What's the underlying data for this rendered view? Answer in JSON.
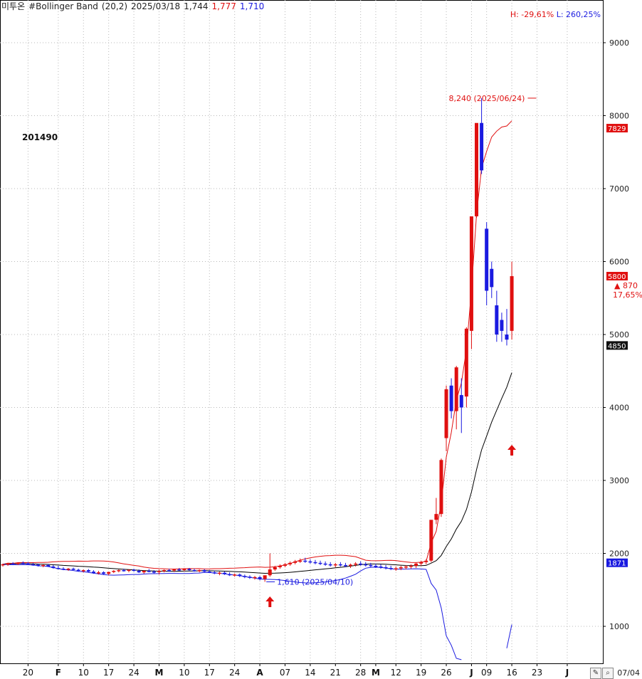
{
  "header": {
    "stock_name": "미투온",
    "indicator": "#Bollinger Band",
    "params": "(20,2)",
    "date": "2025/03/18",
    "close": "1,744",
    "high": "1,777",
    "low": "1,710"
  },
  "hl_stats": {
    "high_label": "H: -29,61%",
    "low_label": "L: 260,25%"
  },
  "ticker_code": "201490",
  "annotations": {
    "high_mark": "8,240 (2025/06/24)",
    "low_mark": "1,610 (2025/04/10)",
    "last_change": "870",
    "last_change_pct": "17,65%"
  },
  "price_badges": {
    "upper_band": "7829",
    "last_close": "5800",
    "middle_band": "4850",
    "lower_band": "1871"
  },
  "date_end": "07/04",
  "colors": {
    "up": "#e01010",
    "down": "#1a1ae0",
    "upper_band": "#e01010",
    "middle_band": "#000000",
    "lower_band": "#1a1ae0",
    "grid": "#b8b8b8"
  },
  "icons": [
    "draw-icon",
    "zoom-icon"
  ],
  "chart_data": {
    "type": "candlestick",
    "title": "미투온 #Bollinger Band (20,2)",
    "ylim": [
      500,
      9500
    ],
    "y_ticks": [
      1000,
      2000,
      3000,
      4000,
      5000,
      6000,
      7000,
      8000,
      9000
    ],
    "y_tick_labels": [
      "1000",
      "2000",
      "3000",
      "4000",
      "5000",
      "6000",
      "7000",
      "8000",
      "9000"
    ],
    "x_axis_labels": [
      {
        "label": "20",
        "bar": 5
      },
      {
        "label": "F",
        "bar": 11
      },
      {
        "label": "10",
        "bar": 16
      },
      {
        "label": "17",
        "bar": 21
      },
      {
        "label": "24",
        "bar": 26
      },
      {
        "label": "M",
        "bar": 31
      },
      {
        "label": "10",
        "bar": 36
      },
      {
        "label": "17",
        "bar": 41
      },
      {
        "label": "24",
        "bar": 46
      },
      {
        "label": "A",
        "bar": 51
      },
      {
        "label": "07",
        "bar": 56
      },
      {
        "label": "14",
        "bar": 61
      },
      {
        "label": "21",
        "bar": 66
      },
      {
        "label": "28",
        "bar": 71
      },
      {
        "label": "M",
        "bar": 74
      },
      {
        "label": "12",
        "bar": 78
      },
      {
        "label": "19",
        "bar": 83
      },
      {
        "label": "26",
        "bar": 88
      },
      {
        "label": "J",
        "bar": 93
      },
      {
        "label": "09",
        "bar": 96
      },
      {
        "label": "16",
        "bar": 101
      },
      {
        "label": "23",
        "bar": 106
      },
      {
        "label": "J",
        "bar": 112
      }
    ],
    "candles": [
      [
        1840,
        1860,
        1820,
        1850
      ],
      [
        1850,
        1870,
        1830,
        1860
      ],
      [
        1860,
        1880,
        1840,
        1855
      ],
      [
        1855,
        1875,
        1840,
        1870
      ],
      [
        1870,
        1890,
        1850,
        1865
      ],
      [
        1865,
        1880,
        1840,
        1850
      ],
      [
        1850,
        1870,
        1830,
        1845
      ],
      [
        1845,
        1860,
        1820,
        1830
      ],
      [
        1830,
        1850,
        1810,
        1840
      ],
      [
        1840,
        1855,
        1815,
        1820
      ],
      [
        1820,
        1840,
        1790,
        1800
      ],
      [
        1800,
        1830,
        1780,
        1790
      ],
      [
        1790,
        1810,
        1770,
        1780
      ],
      [
        1780,
        1800,
        1760,
        1790
      ],
      [
        1790,
        1805,
        1770,
        1775
      ],
      [
        1775,
        1790,
        1750,
        1760
      ],
      [
        1760,
        1780,
        1740,
        1770
      ],
      [
        1770,
        1785,
        1740,
        1750
      ],
      [
        1750,
        1770,
        1720,
        1730
      ],
      [
        1730,
        1760,
        1710,
        1740
      ],
      [
        1740,
        1755,
        1710,
        1720
      ],
      [
        1720,
        1750,
        1700,
        1745
      ],
      [
        1745,
        1770,
        1730,
        1760
      ],
      [
        1760,
        1780,
        1740,
        1770
      ],
      [
        1770,
        1790,
        1750,
        1760
      ],
      [
        1760,
        1780,
        1740,
        1775
      ],
      [
        1775,
        1790,
        1750,
        1760
      ],
      [
        1760,
        1780,
        1730,
        1740
      ],
      [
        1740,
        1770,
        1720,
        1760
      ],
      [
        1760,
        1785,
        1740,
        1750
      ],
      [
        1750,
        1770,
        1720,
        1744
      ],
      [
        1744,
        1777,
        1710,
        1760
      ],
      [
        1760,
        1780,
        1740,
        1770
      ],
      [
        1770,
        1790,
        1750,
        1765
      ],
      [
        1765,
        1785,
        1745,
        1780
      ],
      [
        1780,
        1800,
        1760,
        1775
      ],
      [
        1775,
        1795,
        1755,
        1785
      ],
      [
        1785,
        1800,
        1760,
        1770
      ],
      [
        1770,
        1790,
        1750,
        1760
      ],
      [
        1760,
        1780,
        1740,
        1770
      ],
      [
        1770,
        1785,
        1740,
        1750
      ],
      [
        1750,
        1770,
        1730,
        1740
      ],
      [
        1740,
        1760,
        1715,
        1725
      ],
      [
        1725,
        1750,
        1700,
        1735
      ],
      [
        1735,
        1750,
        1705,
        1715
      ],
      [
        1715,
        1740,
        1690,
        1700
      ],
      [
        1700,
        1725,
        1680,
        1710
      ],
      [
        1710,
        1725,
        1675,
        1690
      ],
      [
        1690,
        1710,
        1660,
        1680
      ],
      [
        1680,
        1700,
        1650,
        1665
      ],
      [
        1665,
        1690,
        1640,
        1675
      ],
      [
        1675,
        1690,
        1630,
        1650
      ],
      [
        1650,
        1680,
        1610,
        1700
      ],
      [
        1700,
        2000,
        1680,
        1780
      ],
      [
        1780,
        1830,
        1760,
        1810
      ],
      [
        1810,
        1850,
        1790,
        1830
      ],
      [
        1830,
        1870,
        1810,
        1850
      ],
      [
        1850,
        1890,
        1830,
        1870
      ],
      [
        1870,
        1910,
        1850,
        1890
      ],
      [
        1890,
        1930,
        1870,
        1900
      ],
      [
        1900,
        1940,
        1870,
        1890
      ],
      [
        1890,
        1920,
        1860,
        1880
      ],
      [
        1880,
        1910,
        1850,
        1870
      ],
      [
        1870,
        1900,
        1840,
        1860
      ],
      [
        1860,
        1890,
        1830,
        1850
      ],
      [
        1850,
        1880,
        1820,
        1840
      ],
      [
        1840,
        1870,
        1810,
        1850
      ],
      [
        1850,
        1880,
        1820,
        1840
      ],
      [
        1840,
        1870,
        1810,
        1830
      ],
      [
        1830,
        1860,
        1800,
        1845
      ],
      [
        1845,
        1880,
        1820,
        1860
      ],
      [
        1860,
        1890,
        1830,
        1850
      ],
      [
        1850,
        1880,
        1820,
        1840
      ],
      [
        1840,
        1870,
        1810,
        1830
      ],
      [
        1830,
        1860,
        1800,
        1820
      ],
      [
        1820,
        1850,
        1790,
        1810
      ],
      [
        1810,
        1840,
        1780,
        1800
      ],
      [
        1800,
        1830,
        1770,
        1790
      ],
      [
        1790,
        1820,
        1760,
        1795
      ],
      [
        1795,
        1830,
        1770,
        1810
      ],
      [
        1810,
        1840,
        1780,
        1820
      ],
      [
        1820,
        1850,
        1790,
        1830
      ],
      [
        1830,
        1870,
        1800,
        1860
      ],
      [
        1860,
        1900,
        1830,
        1880
      ],
      [
        1880,
        1920,
        1850,
        1900
      ],
      [
        1900,
        2100,
        1880,
        2460
      ],
      [
        2460,
        2760,
        2400,
        2540
      ],
      [
        2540,
        3300,
        2500,
        3280
      ],
      [
        3580,
        4300,
        3400,
        4250
      ],
      [
        4300,
        4400,
        3850,
        3950
      ],
      [
        3950,
        4570,
        3700,
        4550
      ],
      [
        4170,
        4400,
        3650,
        4000
      ],
      [
        4150,
        5100,
        4000,
        5080
      ],
      [
        5050,
        5600,
        4800,
        6620
      ],
      [
        6620,
        7000,
        6600,
        7900
      ],
      [
        7900,
        8240,
        7200,
        7250
      ],
      [
        6450,
        6540,
        5400,
        5600
      ],
      [
        5900,
        6000,
        5500,
        5650
      ],
      [
        5400,
        5600,
        4900,
        5000
      ],
      [
        5200,
        5300,
        4900,
        5050
      ],
      [
        5000,
        5350,
        4850,
        4930
      ],
      [
        5050,
        6000,
        4930,
        5800
      ]
    ],
    "series": [
      {
        "name": "upper",
        "values": []
      },
      {
        "name": "middle",
        "values": []
      },
      {
        "name": "lower",
        "values": []
      }
    ],
    "grid": true
  }
}
